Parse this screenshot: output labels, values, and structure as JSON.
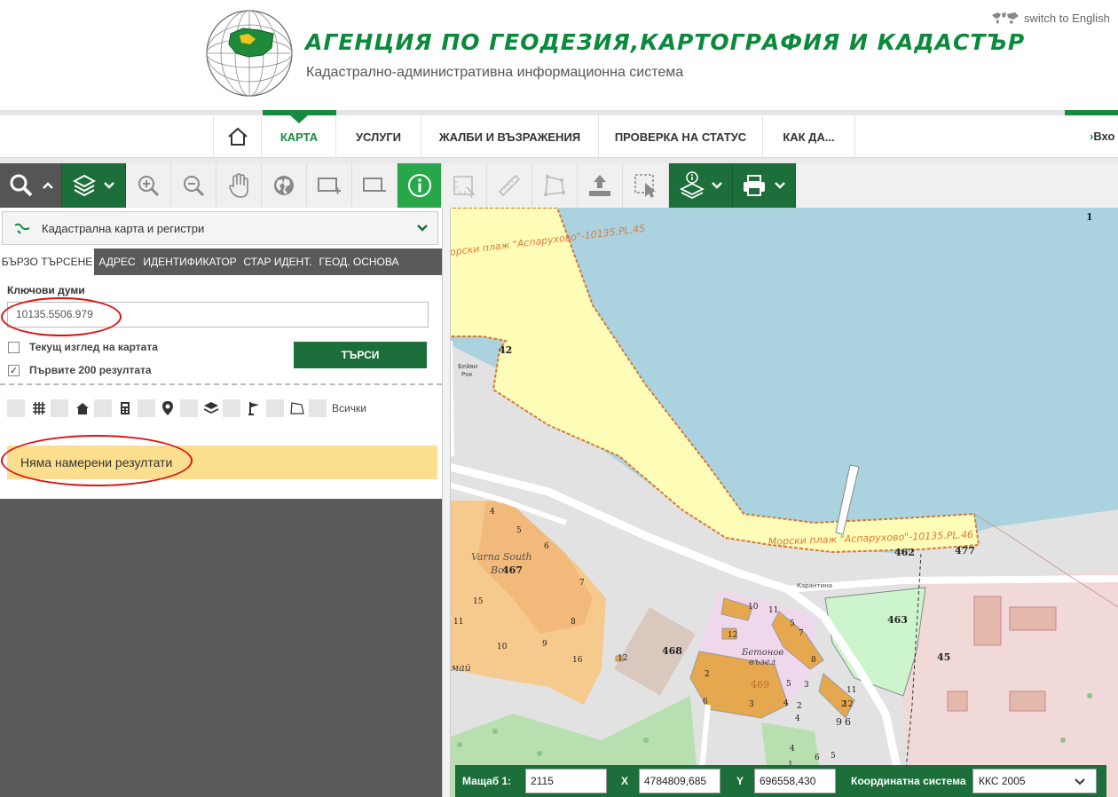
{
  "header": {
    "title": "АГЕНЦИЯ ПО ГЕОДЕЗИЯ,КАРТОГРАФИЯ И КАДАСТЪР",
    "subtitle": "Кадастрално-административна информационна система",
    "lang_switch": "switch to English"
  },
  "nav": {
    "items": [
      {
        "label": "КАРТА",
        "active": true
      },
      {
        "label": "УСЛУГИ"
      },
      {
        "label": "ЖАЛБИ И ВЪЗРАЖЕНИЯ"
      },
      {
        "label": "ПРОВЕРКА НА СТАТУС"
      },
      {
        "label": "КАК ДА..."
      }
    ],
    "login": "Вхо"
  },
  "toolbar": {
    "icons": [
      "search-icon",
      "layers-icon",
      "zoom-in-icon",
      "zoom-out-icon",
      "pan-hand-icon",
      "globe-icon",
      "zoom-box-in-icon",
      "zoom-box-out-icon",
      "info-icon",
      "measure-area-icon",
      "ruler-icon",
      "polygon-icon",
      "upload-icon",
      "select-area-icon",
      "layer-info-icon",
      "print-icon"
    ]
  },
  "panel": {
    "layer_select": "Кадастрална карта и регистри",
    "tabs": [
      "БЪРЗО ТЪРСЕНЕ",
      "АДРЕС",
      "ИДЕНТИФИКАТОР",
      "СТАР ИДЕНТ.",
      "ГЕОД. ОСНОВА"
    ],
    "keywords_label": "Ключови думи",
    "keywords_value": "10135.5506.979",
    "current_view_label": "Текущ изглед на картата",
    "first200_label": "Първите 200 резултата",
    "search_button": "ТЪРСИ",
    "filter_all": "Всички",
    "no_results": "Няма намерени резултати"
  },
  "map": {
    "labels": {
      "beach_top": "Морски плаж \"Аспарухово\"-10135.PL.45",
      "beach_bottom": "Морски плаж \"Аспарухово\"-10135.PL.46",
      "varna_south": "Varna South",
      "varna_south_2": "Bo",
      "betonov": "Бетонов",
      "vazel": "възел",
      "karantina": "Карантина",
      "beivi": "Бейви",
      "rok": "Рок",
      "may": "май",
      "corner": "1",
      "parcels": [
        "42",
        "4",
        "5",
        "6",
        "467",
        "7",
        "15",
        "8",
        "11",
        "10",
        "9",
        "16",
        "468",
        "10",
        "11",
        "12",
        "12",
        "2",
        "469",
        "3",
        "4",
        "5",
        "2",
        "6",
        "4",
        "3",
        "11",
        "2",
        "9",
        "6",
        "463",
        "462",
        "477",
        "45",
        "8",
        "7",
        "5",
        "12",
        "1",
        "6",
        "5",
        "4"
      ]
    }
  },
  "statusbar": {
    "scale_label": "Мащаб 1:",
    "scale_value": "2115",
    "x_label": "X",
    "x_value": "4784809,685",
    "y_label": "Y",
    "y_value": "696558,430",
    "crs_label": "Координатна система",
    "crs_value": "ККС 2005"
  }
}
